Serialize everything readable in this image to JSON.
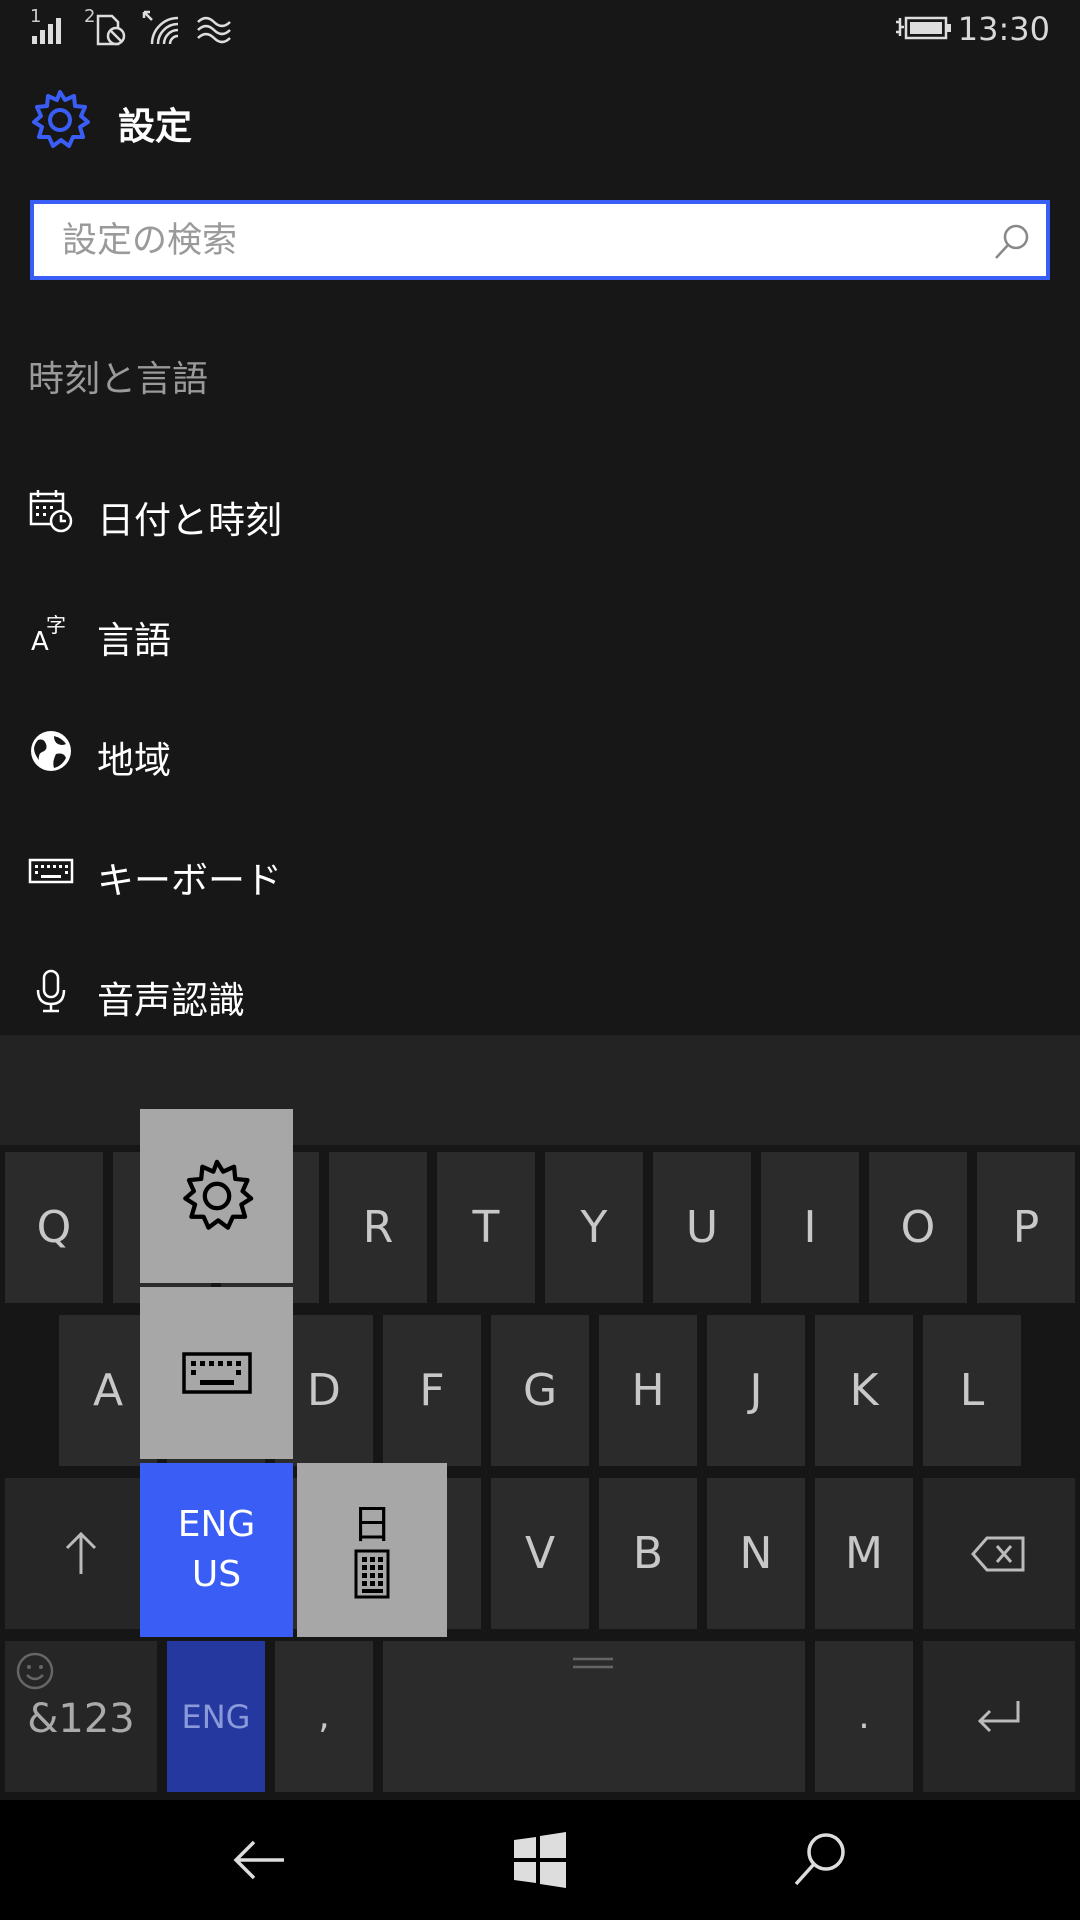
{
  "status_bar": {
    "time": "13:30",
    "sim1_label": "1",
    "sim2_label": "2",
    "icons": [
      "signal-icon",
      "sim2-data-icon",
      "wifi-icon",
      "data-saver-icon",
      "battery-charging-icon"
    ]
  },
  "header": {
    "title": "設定"
  },
  "search": {
    "placeholder": "設定の検索"
  },
  "section": {
    "title": "時刻と言語"
  },
  "menu": {
    "items": [
      {
        "label": "日付と時刻",
        "icon": "calendar-clock-icon"
      },
      {
        "label": "言語",
        "icon": "language-icon"
      },
      {
        "label": "地域",
        "icon": "globe-icon"
      },
      {
        "label": "キーボード",
        "icon": "keyboard-icon"
      },
      {
        "label": "音声認識",
        "icon": "microphone-icon"
      }
    ]
  },
  "keyboard": {
    "row1": [
      "Q",
      "R",
      "T",
      "Y",
      "U",
      "I",
      "O",
      "P"
    ],
    "row2": [
      "A",
      "D",
      "F",
      "G",
      "H",
      "J",
      "K",
      "L"
    ],
    "row3": [
      "V",
      "B",
      "N",
      "M"
    ],
    "symbols_label": "&123",
    "lang_key_label": "ENG",
    "comma": ",",
    "period": ".",
    "shift_icon": "shift-icon",
    "backspace_icon": "backspace-icon",
    "enter_icon": "enter-icon",
    "emoji_icon": "emoji-icon"
  },
  "language_popup": {
    "settings_icon": "gear-icon",
    "layout_icon": "keyboard-icon",
    "current_line1": "ENG",
    "current_line2": "US",
    "japanese_char": "日",
    "japanese_icon": "keypad-icon"
  },
  "nav_bar": {
    "icons": [
      "back-arrow-icon",
      "windows-logo-icon",
      "search-icon"
    ]
  },
  "colors": {
    "accent": "#3a5ef5",
    "background": "#171717",
    "keyboard_key": "#2b2b2b",
    "popup_tile": "#a7a7a7"
  }
}
